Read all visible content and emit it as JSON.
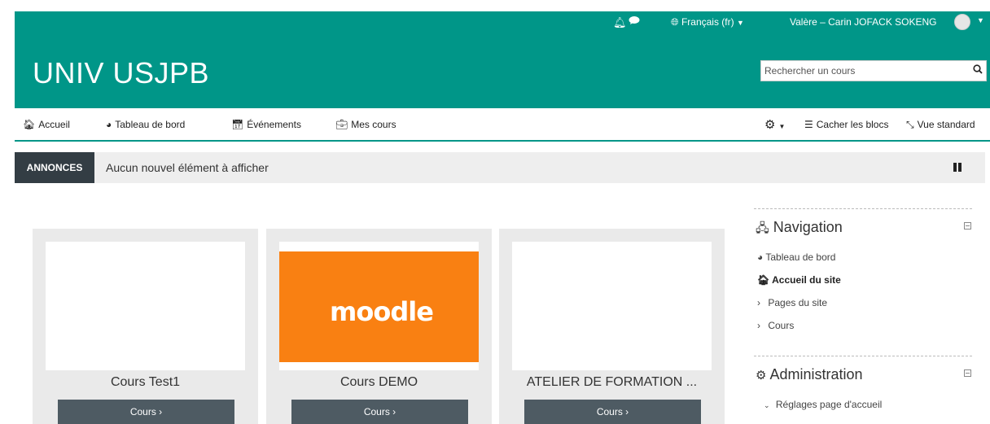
{
  "topbar": {
    "icons": {
      "notifications": "bell-icon",
      "messages": "chat-icon",
      "language": "globe-icon"
    },
    "language": "Français (fr)",
    "user_name": "Valère – Carin JOFACK SOKENG"
  },
  "header": {
    "site_name": "UNIV USJPB",
    "search_placeholder": "Rechercher un cours"
  },
  "nav": {
    "items": [
      {
        "label": "Accueil",
        "icon": "home-icon"
      },
      {
        "label": "Tableau de bord",
        "icon": "dashboard-icon"
      },
      {
        "label": "Événements",
        "icon": "calendar-icon"
      },
      {
        "label": "Mes cours",
        "icon": "briefcase-icon"
      }
    ],
    "hide_blocks": "Cacher les blocs",
    "standard_view": "Vue standard"
  },
  "announcements": {
    "tag": "ANNONCES",
    "message": "Aucun nouvel élément à afficher"
  },
  "courses": [
    {
      "title": "Cours Test1",
      "button": "Cours ›",
      "image": ""
    },
    {
      "title": "Cours DEMO",
      "button": "Cours ›",
      "image": "moodle"
    },
    {
      "title": "ATELIER DE FORMATION ...",
      "button": "Cours ›",
      "image": ""
    }
  ],
  "moodle_logo_text": "moodle",
  "navigation_block": {
    "title": "Navigation",
    "items": [
      "Tableau de bord",
      "Accueil du site",
      "Pages du site",
      "Cours"
    ]
  },
  "administration_block": {
    "title": "Administration",
    "items": [
      "Réglages page d'accueil"
    ]
  },
  "colors": {
    "brand": "#009688",
    "dark": "#333d44",
    "button": "#4e5b63",
    "moodle_orange": "#f98012"
  }
}
